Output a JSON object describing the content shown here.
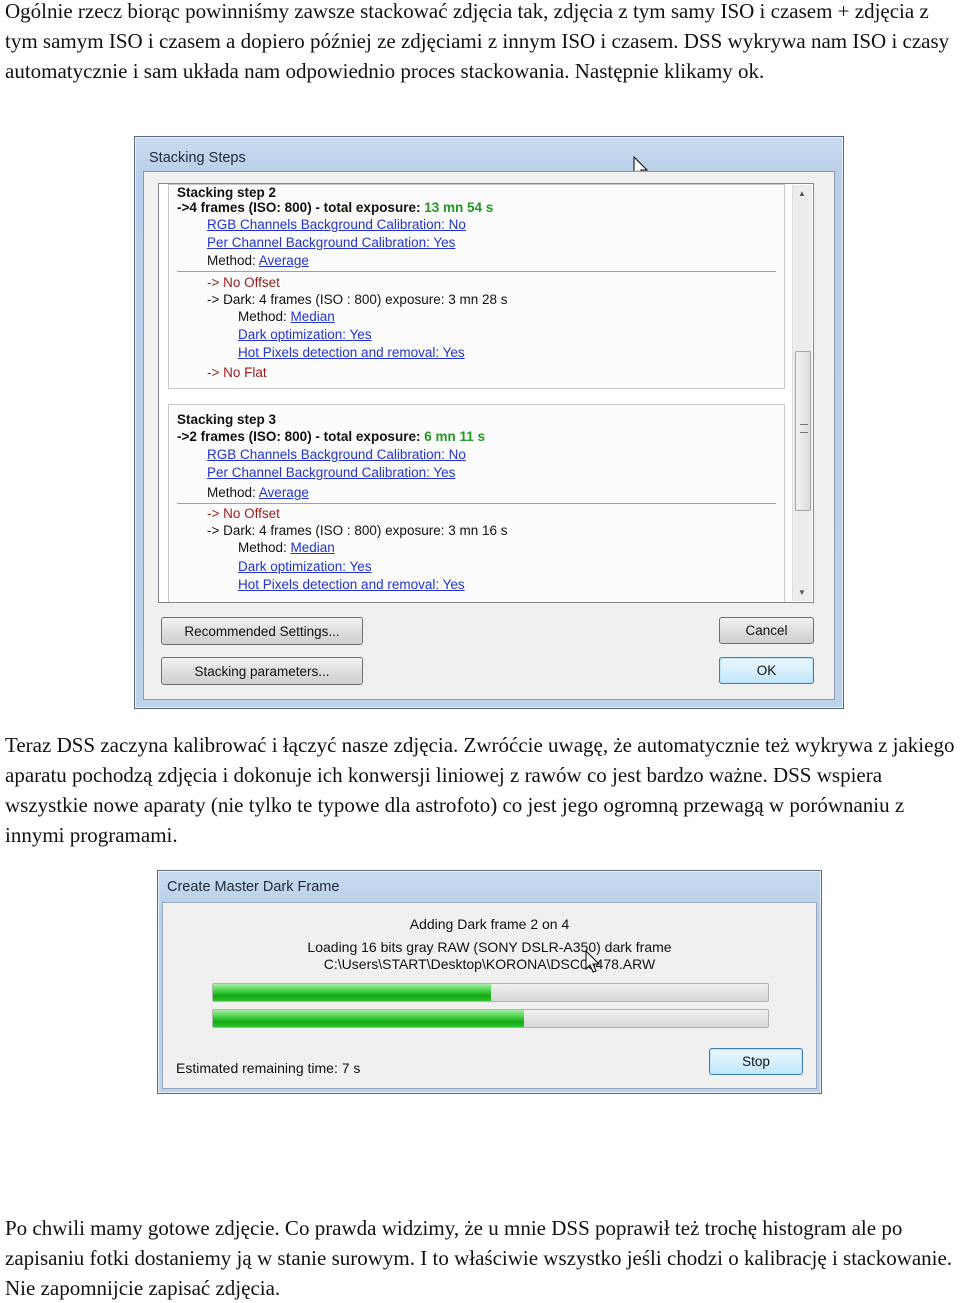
{
  "paragraphs": [
    "Ogólnie rzecz biorąc powinniśmy zawsze stackować zdjęcia tak, zdjęcia z tym samy ISO i czasem + zdjęcia z tym samym ISO i czasem a dopiero później ze zdjęciami z innym ISO i czasem. DSS wykrywa nam ISO i czasy automatycznie i sam układa nam odpowiednio proces stackowania. Następnie klikamy ok.",
    "Teraz DSS zaczyna kalibrować i łączyć nasze zdjęcia. Zwróćcie uwagę, że automatycznie też wykrywa z jakiego aparatu pochodzą zdjęcia i dokonuje ich konwersji liniowej z rawów co jest bardzo ważne. DSS wspiera wszystkie nowe aparaty (nie tylko te typowe dla astrofoto) co jest jego ogromną przewagą w porównaniu z innymi programami.",
    "Po chwili mamy gotowe zdjęcie. Co prawda widzimy, że u mnie DSS poprawił też trochę histogram ale po zapisaniu fotki dostaniemy ją w stanie surowym. I to właściwie wszystko jeśli chodzi o kalibrację i stackowanie. Nie zapomnijcie zapisać zdjęcia."
  ],
  "stacking_dialog": {
    "title": "Stacking Steps",
    "steps": [
      {
        "header": "Stacking step 2",
        "frames": "->4 frames (ISO: 800) - total exposure: ",
        "exposure": "13 mn 54 s",
        "rgb_calibration": "RGB Channels Background Calibration: No",
        "per_channel_calibration": "Per Channel Background Calibration: Yes",
        "method_label": "Method: ",
        "method": "Average",
        "offset": "-> No Offset",
        "dark": "-> Dark: 4 frames (ISO : 800) exposure: 3 mn 28 s",
        "dark_method_label": "Method: ",
        "dark_method": "Median",
        "dark_optimization": "Dark optimization: Yes",
        "hot_pixels": "Hot Pixels detection and removal: Yes",
        "flat": "-> No Flat"
      },
      {
        "header": "Stacking step 3",
        "frames": "->2 frames (ISO: 800) - total exposure: ",
        "exposure": "6 mn 11 s",
        "rgb_calibration": "RGB Channels Background Calibration: No",
        "per_channel_calibration": "Per Channel Background Calibration: Yes",
        "method_label": "Method: ",
        "method": "Average",
        "offset": "-> No Offset",
        "dark": "-> Dark: 4 frames (ISO : 800) exposure: 3 mn 16 s",
        "dark_method_label": "Method: ",
        "dark_method": "Median",
        "dark_optimization": "Dark optimization: Yes",
        "hot_pixels": "Hot Pixels detection and removal: Yes"
      }
    ],
    "buttons": {
      "recommended": "Recommended Settings...",
      "parameters": "Stacking parameters...",
      "cancel": "Cancel",
      "ok": "OK"
    }
  },
  "dark_dialog": {
    "title": "Create Master Dark Frame",
    "status": "Adding Dark frame 2 on 4",
    "loading": "Loading 16 bits gray RAW (SONY DSLR-A350) dark frame",
    "path": "C:\\Users\\START\\Desktop\\KORONA\\DSC03478.ARW",
    "progress_1": 50,
    "progress_2": 56,
    "remaining": "Estimated remaining time: 7 s",
    "stop": "Stop"
  },
  "colors": {
    "exposure_green": "#1f9a1f",
    "link_blue": "#2233cc",
    "warning_red": "#9b1b1b",
    "progress_green": "#14a814"
  }
}
